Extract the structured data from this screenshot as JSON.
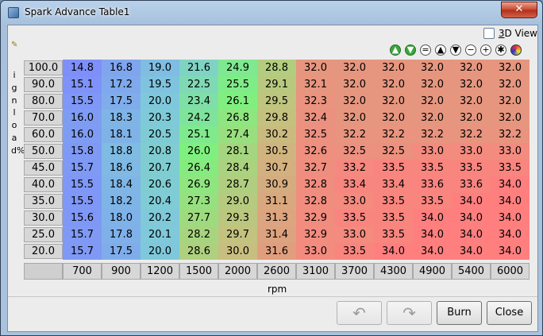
{
  "window": {
    "title": "Spark Advance Table1",
    "close_glyph": "✕"
  },
  "view3d": {
    "label_u": "3",
    "label_rest": "D View",
    "checked": false
  },
  "toolbar": {
    "icons": [
      {
        "name": "up-green-icon",
        "glyph": "▲"
      },
      {
        "name": "down-green-icon",
        "glyph": "▼"
      },
      {
        "name": "equals-icon",
        "glyph": "="
      },
      {
        "name": "increase-icon",
        "glyph": "▲"
      },
      {
        "name": "decrease-icon",
        "glyph": "▼"
      },
      {
        "name": "minus-icon",
        "glyph": "−"
      },
      {
        "name": "plus-icon",
        "glyph": "+"
      },
      {
        "name": "multiply-icon",
        "glyph": "✱"
      },
      {
        "name": "color-palette-icon",
        "glyph": ""
      }
    ]
  },
  "yaxis": {
    "title": "ignload%",
    "values": [
      "100.0",
      "90.0",
      "80.0",
      "70.0",
      "60.0",
      "50.0",
      "45.0",
      "40.0",
      "35.0",
      "30.0",
      "25.0",
      "20.0"
    ]
  },
  "xaxis": {
    "title": "rpm",
    "values": [
      "700",
      "900",
      "1200",
      "1500",
      "2000",
      "2600",
      "3100",
      "3700",
      "4300",
      "4900",
      "5400",
      "6000"
    ]
  },
  "table": {
    "rows": [
      [
        "14.8",
        "16.8",
        "19.0",
        "21.6",
        "24.9",
        "28.8",
        "32.0",
        "32.0",
        "32.0",
        "32.0",
        "32.0",
        "32.0"
      ],
      [
        "15.1",
        "17.2",
        "19.5",
        "22.5",
        "25.5",
        "29.1",
        "32.1",
        "32.0",
        "32.0",
        "32.0",
        "32.0",
        "32.0"
      ],
      [
        "15.5",
        "17.5",
        "20.0",
        "23.4",
        "26.1",
        "29.5",
        "32.3",
        "32.0",
        "32.0",
        "32.0",
        "32.0",
        "32.0"
      ],
      [
        "16.0",
        "18.3",
        "20.3",
        "24.2",
        "26.8",
        "29.8",
        "32.4",
        "32.0",
        "32.0",
        "32.0",
        "32.0",
        "32.0"
      ],
      [
        "16.0",
        "18.1",
        "20.5",
        "25.1",
        "27.4",
        "30.2",
        "32.5",
        "32.2",
        "32.2",
        "32.2",
        "32.2",
        "32.2"
      ],
      [
        "15.8",
        "18.8",
        "20.8",
        "26.0",
        "28.1",
        "30.5",
        "32.6",
        "32.5",
        "32.5",
        "33.0",
        "33.0",
        "33.0"
      ],
      [
        "15.7",
        "18.6",
        "20.7",
        "26.4",
        "28.4",
        "30.7",
        "32.7",
        "33.2",
        "33.5",
        "33.5",
        "33.5",
        "33.5"
      ],
      [
        "15.5",
        "18.4",
        "20.6",
        "26.9",
        "28.7",
        "30.9",
        "32.8",
        "33.4",
        "33.4",
        "33.6",
        "33.6",
        "34.0"
      ],
      [
        "15.5",
        "18.2",
        "20.4",
        "27.3",
        "29.0",
        "31.1",
        "32.8",
        "33.0",
        "33.5",
        "33.5",
        "34.0",
        "34.0"
      ],
      [
        "15.6",
        "18.0",
        "20.2",
        "27.7",
        "29.3",
        "31.3",
        "32.9",
        "33.5",
        "33.5",
        "34.0",
        "34.0",
        "34.0"
      ],
      [
        "15.7",
        "17.8",
        "20.1",
        "28.2",
        "29.7",
        "31.4",
        "32.9",
        "33.0",
        "33.5",
        "34.0",
        "34.0",
        "34.0"
      ],
      [
        "15.7",
        "17.5",
        "20.0",
        "28.6",
        "30.0",
        "31.6",
        "33.0",
        "33.5",
        "34.0",
        "34.0",
        "34.0",
        "34.0"
      ]
    ]
  },
  "buttons": {
    "undo_glyph": "↶",
    "redo_glyph": "↷",
    "burn_label": "Burn",
    "close_label": "Close"
  },
  "colors": {
    "blue": "#7f86ff",
    "green": "#7ff07f",
    "red": "#ff7f7f"
  }
}
